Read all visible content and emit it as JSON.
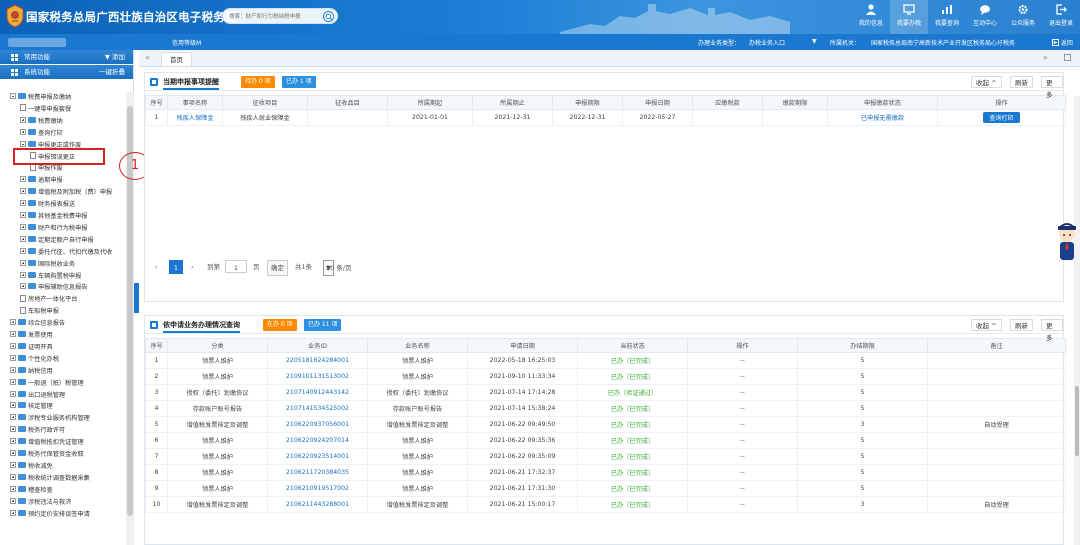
{
  "header": {
    "site_title": "国家税务总局广西壮族自治区电子税务局",
    "search_placeholder": "搜索：财产和行为税纳税申报",
    "nav": [
      {
        "label": "我的信息",
        "icon": "user-icon"
      },
      {
        "label": "我要办税",
        "icon": "monitor-icon",
        "active": true
      },
      {
        "label": "我要查询",
        "icon": "chart-icon"
      },
      {
        "label": "互动中心",
        "icon": "chat-icon"
      },
      {
        "label": "公众服务",
        "icon": "gear-icon"
      },
      {
        "label": "退出登录",
        "icon": "logout-icon"
      }
    ]
  },
  "subbar": {
    "user_tag": "信用等级M",
    "biz_type_label": "办理业务类型：",
    "biz_type_value": "办税业务入口",
    "caret": "▼",
    "org_label": "所属机关：",
    "org_name": "国家税务总局南宁高新技术产业开发区税务局心圩税务",
    "back": "返回"
  },
  "sidebar": {
    "common_func": "常用功能",
    "add": "添加",
    "sys_func": "系统功能",
    "fold_all": "一键折叠",
    "tree": [
      {
        "label": "税费申报及缴纳",
        "indent": 0,
        "type": "minus-folder"
      },
      {
        "label": "一键零申报套餐",
        "indent": 1,
        "type": "doc"
      },
      {
        "label": "税费缴纳",
        "indent": 1,
        "type": "plus-folder"
      },
      {
        "label": "查询打印",
        "indent": 1,
        "type": "plus-folder"
      },
      {
        "label": "申报更正或作废",
        "indent": 1,
        "type": "minus-folder"
      },
      {
        "label": "申报错误更正",
        "indent": 2,
        "type": "doc"
      },
      {
        "label": "申报作废",
        "indent": 2,
        "type": "doc"
      },
      {
        "label": "逾期申报",
        "indent": 1,
        "type": "plus-folder"
      },
      {
        "label": "增值税及附加税（费）申报",
        "indent": 1,
        "type": "plus-folder"
      },
      {
        "label": "财务报表报送",
        "indent": 1,
        "type": "plus-folder"
      },
      {
        "label": "其他基金税费申报",
        "indent": 1,
        "type": "plus-folder"
      },
      {
        "label": "财产和行为税申报",
        "indent": 1,
        "type": "plus-folder"
      },
      {
        "label": "定期定额户自行申报",
        "indent": 1,
        "type": "plus-folder"
      },
      {
        "label": "委托代征、代扣代缴及代收",
        "indent": 1,
        "type": "plus-folder"
      },
      {
        "label": "国际税收业务",
        "indent": 1,
        "type": "plus-folder"
      },
      {
        "label": "车辆购置税申报",
        "indent": 1,
        "type": "plus-folder"
      },
      {
        "label": "申报辅助信息报告",
        "indent": 1,
        "type": "plus-folder"
      },
      {
        "label": "房地产一体化平台",
        "indent": 1,
        "type": "doc"
      },
      {
        "label": "车船税申报",
        "indent": 1,
        "type": "doc"
      },
      {
        "label": "综合信息报告",
        "indent": 0,
        "type": "plus-folder"
      },
      {
        "label": "发票使用",
        "indent": 0,
        "type": "plus-folder"
      },
      {
        "label": "证明开具",
        "indent": 0,
        "type": "plus-folder"
      },
      {
        "label": "个性化办税",
        "indent": 0,
        "type": "plus-folder"
      },
      {
        "label": "纳税信用",
        "indent": 0,
        "type": "plus-folder"
      },
      {
        "label": "一般退（抵）税管理",
        "indent": 0,
        "type": "plus-folder"
      },
      {
        "label": "出口退税管理",
        "indent": 0,
        "type": "plus-folder"
      },
      {
        "label": "核定管理",
        "indent": 0,
        "type": "plus-folder"
      },
      {
        "label": "涉税专业服务机构管理",
        "indent": 0,
        "type": "plus-folder"
      },
      {
        "label": "税务行政许可",
        "indent": 0,
        "type": "plus-folder"
      },
      {
        "label": "增值税抵扣凭证管理",
        "indent": 0,
        "type": "plus-folder"
      },
      {
        "label": "税务代保管资金收取",
        "indent": 0,
        "type": "plus-folder"
      },
      {
        "label": "税收减免",
        "indent": 0,
        "type": "plus-folder"
      },
      {
        "label": "税收统计调查数据采集",
        "indent": 0,
        "type": "plus-folder"
      },
      {
        "label": "稽查检查",
        "indent": 0,
        "type": "plus-folder"
      },
      {
        "label": "涉税违法与救济",
        "indent": 0,
        "type": "plus-folder"
      },
      {
        "label": "预约定价安排谈签申请",
        "indent": 0,
        "type": "plus-folder"
      }
    ],
    "annotation_number": "1"
  },
  "tabs": {
    "prev": "«",
    "home": "首页",
    "next": "»"
  },
  "panel1": {
    "title": "当期申报事项提醒",
    "badge_pending": "待办 0 项",
    "badge_done": "已办 1 项",
    "collapse": "收起 ^",
    "refresh": "刷新",
    "more": "更多",
    "columns": [
      "序号",
      "事项名称",
      "征收项目",
      "征收品目",
      "所属期起",
      "所属期止",
      "申报期限",
      "申报日期",
      "应缴税款",
      "缴款期限",
      "申报缴款状态",
      "操作"
    ],
    "rows": [
      [
        "1",
        "残疾人保障金",
        "残疾人就业保障金",
        "",
        "2021-01-01",
        "2021-12-31",
        "2022-12-31",
        "2022-05-27",
        "",
        "",
        "已申报无需缴款",
        "查询打印"
      ]
    ],
    "pager": {
      "page": "1",
      "goto": "到第",
      "page_input": "1",
      "page_unit": "页",
      "ok": "确定",
      "total": "共1条",
      "per_page": "20 条/页"
    }
  },
  "panel2": {
    "title": "依申请业务办理情况查询",
    "badge_pending": "在办 0 项",
    "badge_done": "已办 11 项",
    "collapse": "收起 ^",
    "refresh": "刷新",
    "more": "更多",
    "columns": [
      "序号",
      "分类",
      "业务ID",
      "业务名称",
      "申请日期",
      "当前状态",
      "操作",
      "办结期限",
      "备注"
    ],
    "rows": [
      [
        "1",
        "领票人维护",
        "2205181624284001",
        "领票人维护",
        "2022-05-18 16:25:03",
        "已办（已完成）",
        "--",
        "5",
        ""
      ],
      [
        "2",
        "领票人维护",
        "2109101131513002",
        "领票人维护",
        "2021-09-10 11:33:34",
        "已办（已完成）",
        "--",
        "5",
        ""
      ],
      [
        "3",
        "授权（委托）划缴协议",
        "2107140912443142",
        "授权（委托）划缴协议",
        "2021-07-14 17:14:28",
        "已办（验证通过）",
        "--",
        "5",
        ""
      ],
      [
        "4",
        "存款账户账号报告",
        "2107141534525002",
        "存款账户账号报告",
        "2021-07-14 15:38:24",
        "已办（已完成）",
        "--",
        "5",
        ""
      ],
      [
        "5",
        "增值税发票核定及调整",
        "2106220937056001",
        "增值税发票核定及调整",
        "2021-06-22 09:49:50",
        "已办（已完成）",
        "--",
        "3",
        "自动受理"
      ],
      [
        "6",
        "领票人维护",
        "2106220924207014",
        "领票人维护",
        "2021-06-22 09:35:36",
        "已办（已完成）",
        "--",
        "5",
        ""
      ],
      [
        "7",
        "领票人维护",
        "2106220923514001",
        "领票人维护",
        "2021-06-22 09:35:09",
        "已办（已完成）",
        "--",
        "5",
        ""
      ],
      [
        "8",
        "领票人维护",
        "2106211720384035",
        "领票人维护",
        "2021-06-21 17:32:37",
        "已办（已完成）",
        "--",
        "5",
        ""
      ],
      [
        "9",
        "领票人维护",
        "2106210919517002",
        "领票人维护",
        "2021-06-21 17:31:30",
        "已办（已完成）",
        "--",
        "5",
        ""
      ],
      [
        "10",
        "增值税发票核定及调整",
        "2106211443288001",
        "增值税发票核定及调整",
        "2021-06-21 15:00:17",
        "已办（已完成）",
        "--",
        "3",
        "自动受理"
      ]
    ]
  }
}
